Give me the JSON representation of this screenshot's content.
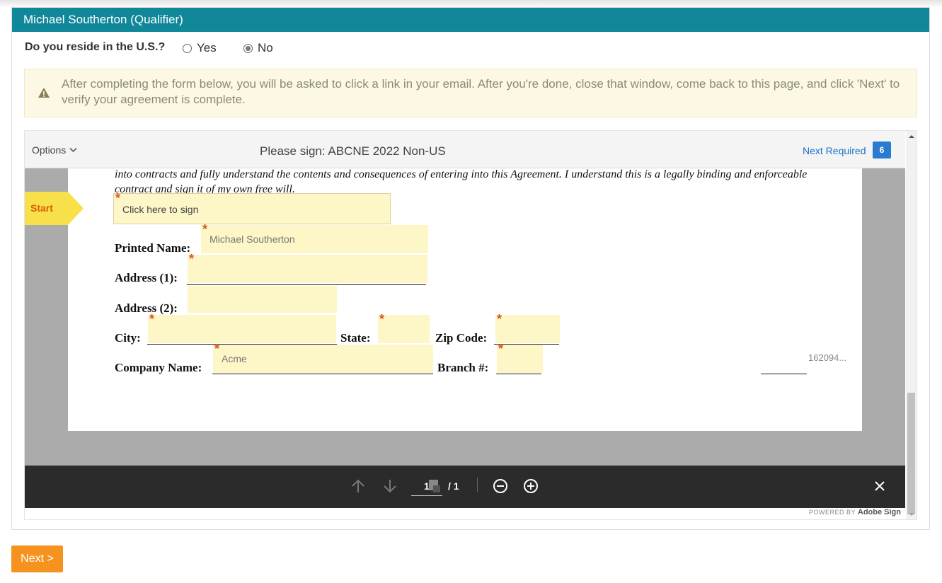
{
  "header": {
    "title": "Michael Southerton (Qualifier)"
  },
  "residence": {
    "question": "Do you reside in the U.S.?",
    "options": [
      {
        "label": "Yes",
        "selected": false
      },
      {
        "label": "No",
        "selected": true
      }
    ]
  },
  "alert": {
    "icon": "warning-icon",
    "text": "After completing the form below, you will be asked to click a link in your email. After you're done, close that window, come back to this page, and click 'Next' to verify your agreement is complete."
  },
  "viewer": {
    "options_label": "Options",
    "title": "Please sign: ABCNE 2022 Non-US",
    "next_required_label": "Next Required",
    "required_count": "6",
    "start_label": "Start",
    "doc": {
      "text": "into contracts and fully understand the contents and consequences of entering into this Agreement. I understand this is a legally binding and enforceable contract and sign it of my own free will.",
      "sign_placeholder": "Click here to sign",
      "printed_name_label": "Printed Name:",
      "printed_name_value": "Michael Southerton",
      "address1_label": "Address (1):",
      "address2_label": "Address (2):",
      "city_label": "City:",
      "state_label": "State:",
      "zip_label": "Zip Code:",
      "company_label": "Company Name:",
      "company_value": "Acme",
      "branch_label": "Branch #:",
      "ref_value": "162094..."
    },
    "pager": {
      "current": "1",
      "total": "/ 1"
    },
    "powered_by": "POWERED BY",
    "brand": "Adobe Sign"
  },
  "footer": {
    "next_label": "Next >"
  },
  "colors": {
    "header": "#11879a",
    "next_button": "#f6931f",
    "field": "#fdf6c7",
    "link": "#1a73c8"
  }
}
